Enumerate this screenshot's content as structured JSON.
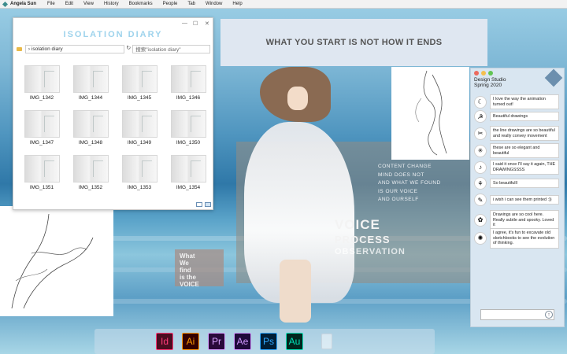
{
  "menubar": {
    "user": "Angela Sun",
    "items": [
      "File",
      "Edit",
      "View",
      "History",
      "Bookmarks",
      "People",
      "Tab",
      "Window",
      "Help"
    ]
  },
  "explorer": {
    "title": "ISOLATION DIARY",
    "path": "isolation diary",
    "search_placeholder": "搜索\"isolation diary\"",
    "files": [
      "IMG_1342",
      "IMG_1344",
      "IMG_1345",
      "IMG_1346",
      "IMG_1347",
      "IMG_1348",
      "IMG_1349",
      "IMG_1350",
      "IMG_1351",
      "IMG_1352",
      "IMG_1353",
      "IMG_1354"
    ]
  },
  "quote": "WHAT YOU START IS NOT HOW IT ENDS",
  "figure": {
    "small_lines": [
      "CONTENT CHANGE",
      "MIND DOES NOT",
      "AND WHAT WE FOUND",
      "IS OUR VOICE",
      "AND OURSELF"
    ],
    "big": [
      "VOICE",
      "PROCESS",
      "OBSERVATION"
    ]
  },
  "card": {
    "lines": [
      "What",
      "We",
      "find",
      "is the",
      "VOICE"
    ]
  },
  "studio": {
    "title_line1": "Design Studio",
    "title_line2": "Spring 2020",
    "dot_colors": [
      "#ec6a5e",
      "#f4bf4f",
      "#61c554"
    ],
    "messages": [
      {
        "text": "I love the way the animation turned out!",
        "icon": "☾"
      },
      {
        "text": "Beautiful drawings",
        "icon": "☭"
      },
      {
        "text": "the line drawings are so beautiful and really convey movement",
        "icon": "✂"
      },
      {
        "text": "these are so elegant and beautiful",
        "icon": "✳"
      },
      {
        "text": "I said it once I'll say it again, THE DRAWINGSSSS",
        "icon": "♪"
      },
      {
        "text": "So beautifulll",
        "icon": "⚘"
      },
      {
        "text": "i wish i can see them printed :))",
        "icon": "✎"
      },
      {
        "text": "Drawings are so cool here. Really subtle and spooky. Loved it",
        "icon": "✿"
      },
      {
        "text": "I agree, it's fun to excavate old sketchbooks to see the evolution of thinking.",
        "icon": "✺"
      }
    ]
  },
  "dock": {
    "apps": [
      {
        "label": "Id",
        "fg": "#ff3b7a",
        "bg": "#4b0d21"
      },
      {
        "label": "Ai",
        "fg": "#ff9a00",
        "bg": "#330000"
      },
      {
        "label": "Pr",
        "fg": "#d7a1ff",
        "bg": "#2a0a3b"
      },
      {
        "label": "Ae",
        "fg": "#cf96fd",
        "bg": "#1f0a3a"
      },
      {
        "label": "Ps",
        "fg": "#31a8ff",
        "bg": "#001e36"
      },
      {
        "label": "Au",
        "fg": "#00e4bb",
        "bg": "#00271f"
      }
    ]
  }
}
